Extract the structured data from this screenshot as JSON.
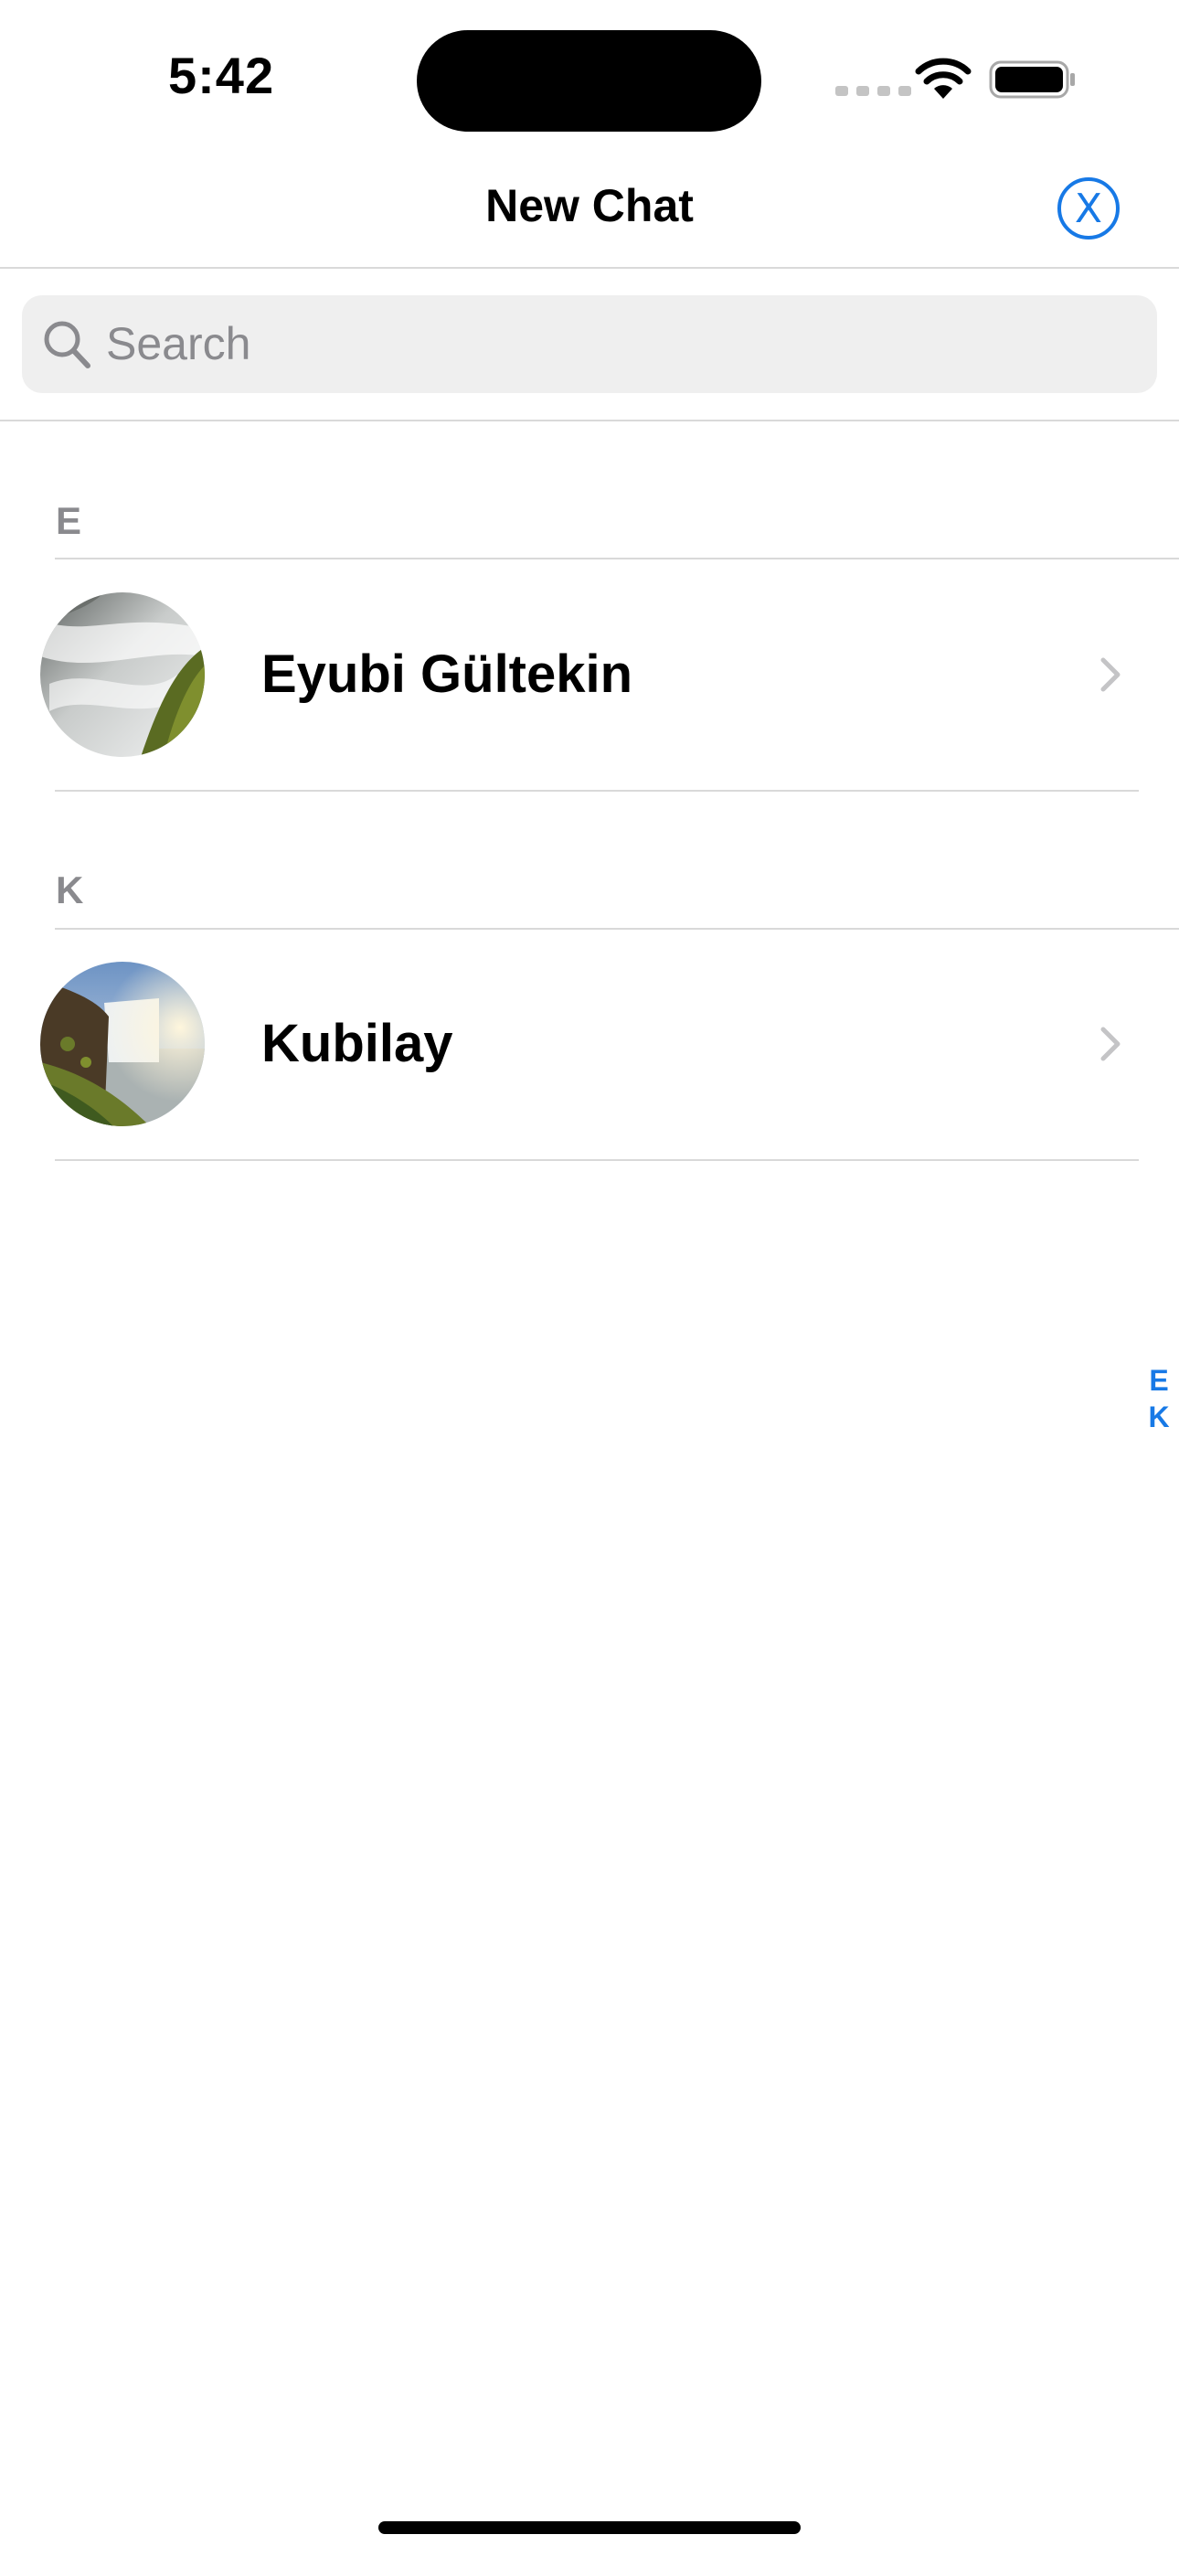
{
  "status_bar": {
    "time": "5:42"
  },
  "header": {
    "title": "New Chat",
    "close_label": "X"
  },
  "search": {
    "placeholder": "Search",
    "value": ""
  },
  "sections": [
    {
      "letter": "E",
      "contacts": [
        {
          "name": "Eyubi Gültekin",
          "avatar": "waterfall-photo"
        }
      ]
    },
    {
      "letter": "K",
      "contacts": [
        {
          "name": "Kubilay",
          "avatar": "waterfall-cliff-photo"
        }
      ]
    }
  ],
  "index": [
    "E",
    "K"
  ],
  "colors": {
    "accent": "#1779e6",
    "secondary_text": "#8a8a8e",
    "divider": "#d9d9d9",
    "search_bg": "#efefef"
  }
}
